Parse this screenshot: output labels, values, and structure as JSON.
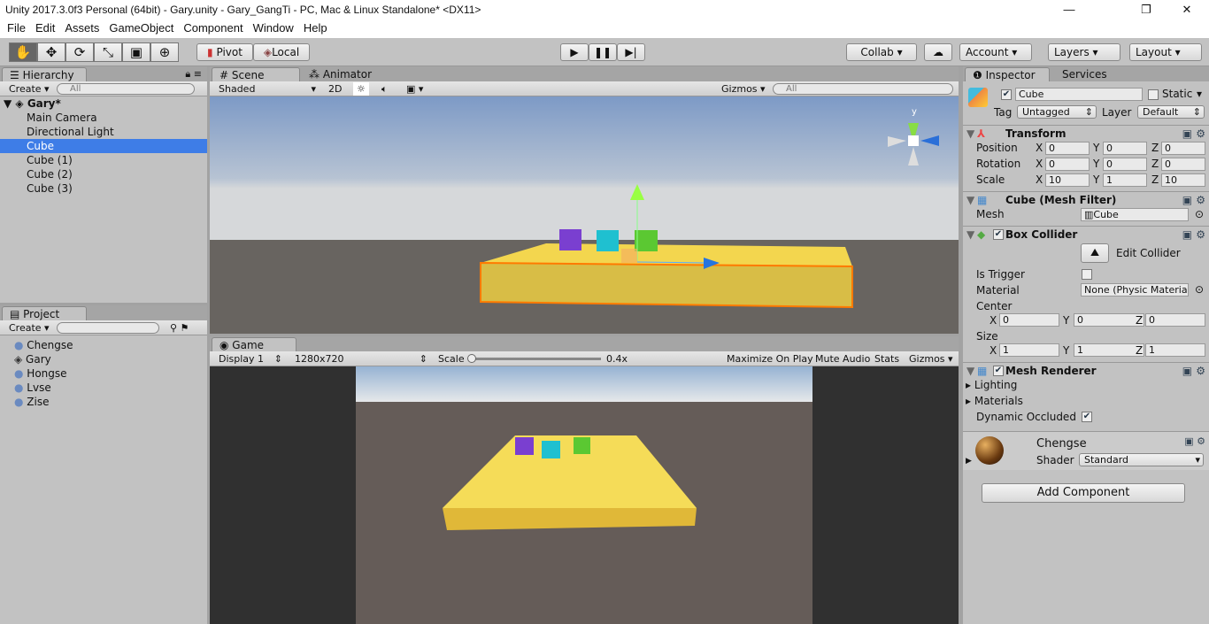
{
  "window": {
    "title": "Unity 2017.3.0f3 Personal (64bit) - Gary.unity - Gary_GangTi - PC, Mac & Linux Standalone* <DX11>",
    "min": "—",
    "max": "❐",
    "close": "✕"
  },
  "menu": [
    "File",
    "Edit",
    "Assets",
    "GameObject",
    "Component",
    "Window",
    "Help"
  ],
  "toolbar": {
    "pivot": "Pivot",
    "local": "Local",
    "collab": "Collab ▾",
    "account": "Account",
    "layers": "Layers",
    "layout": "Layout"
  },
  "hierarchy": {
    "tab": "Hierarchy",
    "create": "Create",
    "search": "All",
    "scene": "Gary*",
    "items": [
      "Main Camera",
      "Directional Light",
      "Cube",
      "Cube (1)",
      "Cube (2)",
      "Cube (3)"
    ],
    "selected": 2
  },
  "project": {
    "tab": "Project",
    "create": "Create",
    "items": [
      "Chengse",
      "Gary",
      "Hongse",
      "Lvse",
      "Zise"
    ]
  },
  "scene": {
    "tab": "Scene",
    "tab2": "Animator",
    "shading": "Shaded",
    "mode2d": "2D",
    "gizmos": "Gizmos",
    "search": "All",
    "axis_y": "y"
  },
  "game": {
    "tab": "Game",
    "display": "Display 1",
    "resolution": "1280x720",
    "scale_label": "Scale",
    "scale_value": "0.4x",
    "scale_fraction": 0.0,
    "maximize": "Maximize On Play",
    "mute": "Mute Audio",
    "stats": "Stats",
    "gizmos": "Gizmos"
  },
  "inspector": {
    "tab": "Inspector",
    "tab2": "Services",
    "name": "Cube",
    "static": "Static",
    "tag_label": "Tag",
    "tag": "Untagged",
    "layer_label": "Layer",
    "layer": "Default",
    "transform": {
      "title": "Transform",
      "rows": [
        {
          "label": "Position",
          "x": "0",
          "y": "0",
          "z": "0"
        },
        {
          "label": "Rotation",
          "x": "0",
          "y": "0",
          "z": "0"
        },
        {
          "label": "Scale",
          "x": "10",
          "y": "1",
          "z": "10"
        }
      ]
    },
    "mesh_filter": {
      "title": "Cube (Mesh Filter)",
      "mesh_label": "Mesh",
      "mesh": "Cube"
    },
    "box_collider": {
      "title": "Box Collider",
      "edit": "Edit Collider",
      "is_trigger": "Is Trigger",
      "material_label": "Material",
      "material": "None (Physic Materia",
      "center": "Center",
      "cx": "0",
      "cy": "0",
      "cz": "0",
      "size": "Size",
      "sx": "1",
      "sy": "1",
      "sz": "1"
    },
    "mesh_renderer": {
      "title": "Mesh Renderer",
      "lighting": "Lighting",
      "materials": "Materials",
      "dynamic": "Dynamic Occluded"
    },
    "material": {
      "name": "Chengse",
      "shader_label": "Shader",
      "shader": "Standard"
    },
    "add_component": "Add Component"
  },
  "colors": {
    "selection": "#3e7de7",
    "platform": "#f2d24c",
    "purple": "#7a3fd0",
    "cyan": "#1fc0d0",
    "green": "#5bc832"
  }
}
